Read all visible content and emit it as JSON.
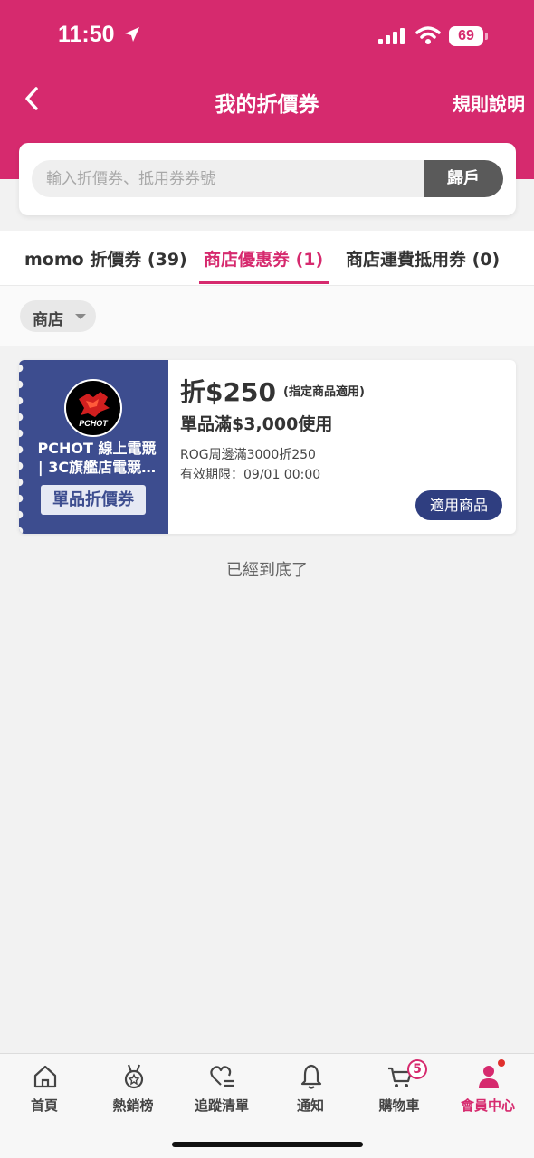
{
  "status_bar": {
    "time": "11:50",
    "battery": "69"
  },
  "header": {
    "title": "我的折價券",
    "rules_label": "規則說明"
  },
  "search": {
    "placeholder": "輸入折價券、抵用券券號",
    "button_label": "歸戶"
  },
  "tabs": [
    {
      "label": "momo 折價券 (39)"
    },
    {
      "label": "商店優惠券 (1)"
    },
    {
      "label": "商店運費抵用券 (0)"
    }
  ],
  "filter": {
    "label": "商店"
  },
  "coupon": {
    "shop_name_line1": "PCHOT 線上電競",
    "shop_name_line2": "| 3C旗艦店電競…",
    "logo_text": "PCHOT",
    "type_label": "單品折價券",
    "amount": "折$250",
    "amount_note": "(指定商品適用)",
    "condition": "單品滿$3,000使用",
    "description": "ROG周邊滿3000折250",
    "expiry": "有效期限：09/01 00:00",
    "apply_label": "適用商品"
  },
  "end_text": "已經到底了",
  "bottom_nav": {
    "items": [
      {
        "label": "首頁",
        "icon": "home-icon"
      },
      {
        "label": "熱銷榜",
        "icon": "medal-icon"
      },
      {
        "label": "追蹤清單",
        "icon": "heart-list-icon"
      },
      {
        "label": "通知",
        "icon": "bell-icon"
      },
      {
        "label": "購物車",
        "icon": "cart-icon"
      },
      {
        "label": "會員中心",
        "icon": "user-icon"
      }
    ],
    "cart_count": "5"
  },
  "colors": {
    "brand": "#d62a6e",
    "coupon_blue": "#3d4d8f"
  }
}
